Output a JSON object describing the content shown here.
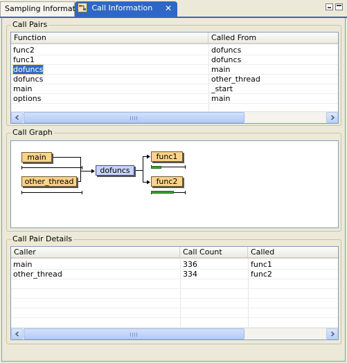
{
  "tabs": [
    {
      "label": "Sampling Information",
      "active": false
    },
    {
      "label": "Call Information",
      "active": true
    }
  ],
  "colors": {
    "accent": "#2f67c8",
    "selection": "#316ac5",
    "node_orange": "#fbd38b",
    "node_blue": "#c8d3f7",
    "bar_green": "#3aa035"
  },
  "call_pairs": {
    "title": "Call Pairs",
    "columns": [
      "Function",
      "Called From"
    ],
    "rows": [
      {
        "function": "func2",
        "called_from": "dofuncs"
      },
      {
        "function": "func1",
        "called_from": "dofuncs"
      },
      {
        "function": "dofuncs",
        "called_from": "main",
        "selected": true
      },
      {
        "function": "dofuncs",
        "called_from": "other_thread"
      },
      {
        "function": "main",
        "called_from": "_start"
      },
      {
        "function": "options",
        "called_from": "main"
      }
    ]
  },
  "call_graph": {
    "title": "Call Graph",
    "nodes": {
      "main": "main",
      "other_thread": "other_thread",
      "dofuncs": "dofuncs",
      "func1": "func1",
      "func2": "func2"
    },
    "bars": {
      "func1": 0.3,
      "func2": 0.65
    }
  },
  "call_pair_details": {
    "title": "Call Pair Details",
    "columns": [
      "Caller",
      "Call Count",
      "Called"
    ],
    "rows": [
      {
        "caller": "main",
        "count": "336",
        "called": "func1"
      },
      {
        "caller": "other_thread",
        "count": "334",
        "called": "func2"
      }
    ]
  }
}
